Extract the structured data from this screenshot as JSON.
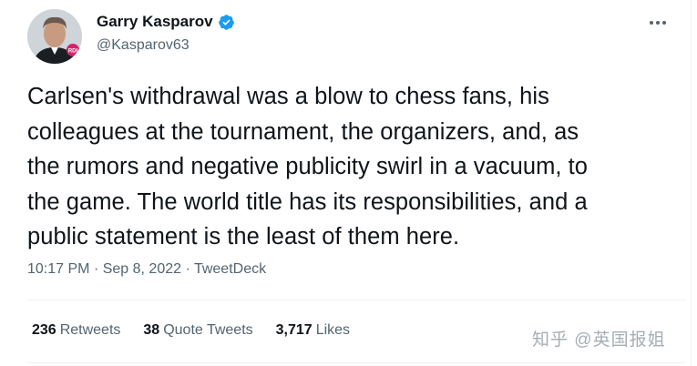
{
  "author": {
    "display_name": "Garry Kasparov",
    "handle": "@Kasparov63",
    "verified_icon": "verified-badge-icon",
    "avatar_badge_text": "RDI"
  },
  "menu": {
    "more_icon": "more-horizontal-icon"
  },
  "tweet": {
    "lines": [
      "Carlsen's withdrawal was a blow to chess fans, his",
      "colleagues at the tournament, the organizers, and, as",
      "the rumors and negative publicity swirl in a vacuum, to",
      "the game. The world title has its responsibilities, and a",
      "public statement is the least of them here."
    ],
    "time": "10:17 PM",
    "date": "Sep 8, 2022",
    "source": "TweetDeck",
    "separator": "·"
  },
  "stats": {
    "retweets_count": "236",
    "retweets_label": "Retweets",
    "quotes_count": "38",
    "quotes_label": "Quote Tweets",
    "likes_count": "3,717",
    "likes_label": "Likes"
  },
  "watermark": {
    "text": "知乎 @英国报姐"
  },
  "colors": {
    "verified": "#1d9bf0",
    "text_primary": "#0f1419",
    "text_secondary": "#536471",
    "divider": "#eff3f4"
  }
}
